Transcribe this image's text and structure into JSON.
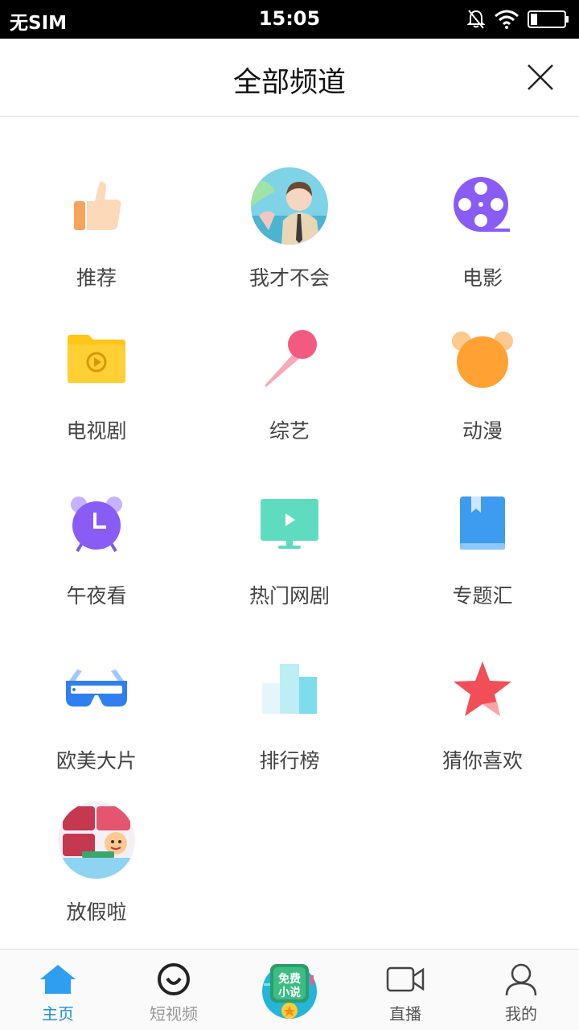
{
  "status_bar": {
    "carrier": "无SIM",
    "time": "15:05",
    "icons": [
      "bell-muted-icon",
      "wifi-icon",
      "battery-icon"
    ]
  },
  "header": {
    "title": "全部频道",
    "close_icon": "close-icon"
  },
  "channels": [
    {
      "label": "推荐",
      "icon": "thumbs-up-icon"
    },
    {
      "label": "我才不会",
      "icon": "avatar-image"
    },
    {
      "label": "电影",
      "icon": "film-reel-icon"
    },
    {
      "label": "电视剧",
      "icon": "folder-play-icon"
    },
    {
      "label": "综艺",
      "icon": "microphone-icon"
    },
    {
      "label": "动漫",
      "icon": "bear-icon"
    },
    {
      "label": "午夜看",
      "icon": "alarm-clock-icon"
    },
    {
      "label": "热门网剧",
      "icon": "tv-play-icon"
    },
    {
      "label": "专题汇",
      "icon": "book-icon"
    },
    {
      "label": "欧美大片",
      "icon": "3d-glasses-icon"
    },
    {
      "label": "排行榜",
      "icon": "bar-chart-icon"
    },
    {
      "label": "猜你喜欢",
      "icon": "star-icon"
    },
    {
      "label": "放假啦",
      "icon": "holiday-badge-image"
    }
  ],
  "bottom_nav": {
    "items": [
      {
        "label": "主页",
        "icon": "home-icon",
        "active": true
      },
      {
        "label": "短视频",
        "icon": "smile-circle-icon"
      },
      {
        "label": "直播",
        "icon": "video-camera-icon"
      },
      {
        "label": "我的",
        "icon": "user-icon"
      }
    ],
    "promo": {
      "text_line1": "免费",
      "text_line2": "小说",
      "icon": "free-novel-badge"
    }
  },
  "colors": {
    "active_blue": "#1f8fe6",
    "label_gray": "#444444"
  }
}
